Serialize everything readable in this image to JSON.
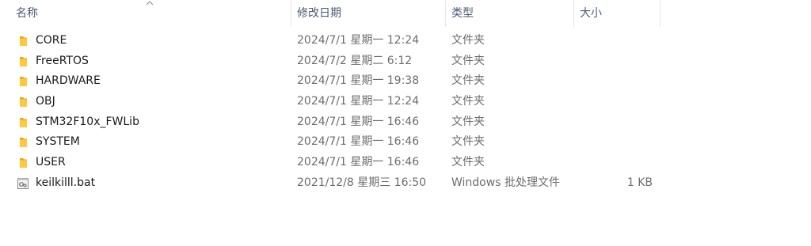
{
  "header": {
    "name": "名称",
    "date": "修改日期",
    "type": "类型",
    "size": "大小"
  },
  "files": [
    {
      "name": "CORE",
      "date": "2024/7/1 星期一 12:24",
      "type": "文件夹",
      "size": "",
      "icon": "folder-icon"
    },
    {
      "name": "FreeRTOS",
      "date": "2024/7/2 星期二 6:12",
      "type": "文件夹",
      "size": "",
      "icon": "folder-icon"
    },
    {
      "name": "HARDWARE",
      "date": "2024/7/1 星期一 19:38",
      "type": "文件夹",
      "size": "",
      "icon": "folder-icon"
    },
    {
      "name": "OBJ",
      "date": "2024/7/1 星期一 12:24",
      "type": "文件夹",
      "size": "",
      "icon": "folder-icon"
    },
    {
      "name": "STM32F10x_FWLib",
      "date": "2024/7/1 星期一 16:46",
      "type": "文件夹",
      "size": "",
      "icon": "folder-icon"
    },
    {
      "name": "SYSTEM",
      "date": "2024/7/1 星期一 16:46",
      "type": "文件夹",
      "size": "",
      "icon": "folder-icon"
    },
    {
      "name": "USER",
      "date": "2024/7/1 星期一 16:46",
      "type": "文件夹",
      "size": "",
      "icon": "folder-icon"
    },
    {
      "name": "keilkilll.bat",
      "date": "2021/12/8 星期三 16:50",
      "type": "Windows 批处理文件",
      "size": "1 KB",
      "icon": "batch-file-icon"
    }
  ]
}
